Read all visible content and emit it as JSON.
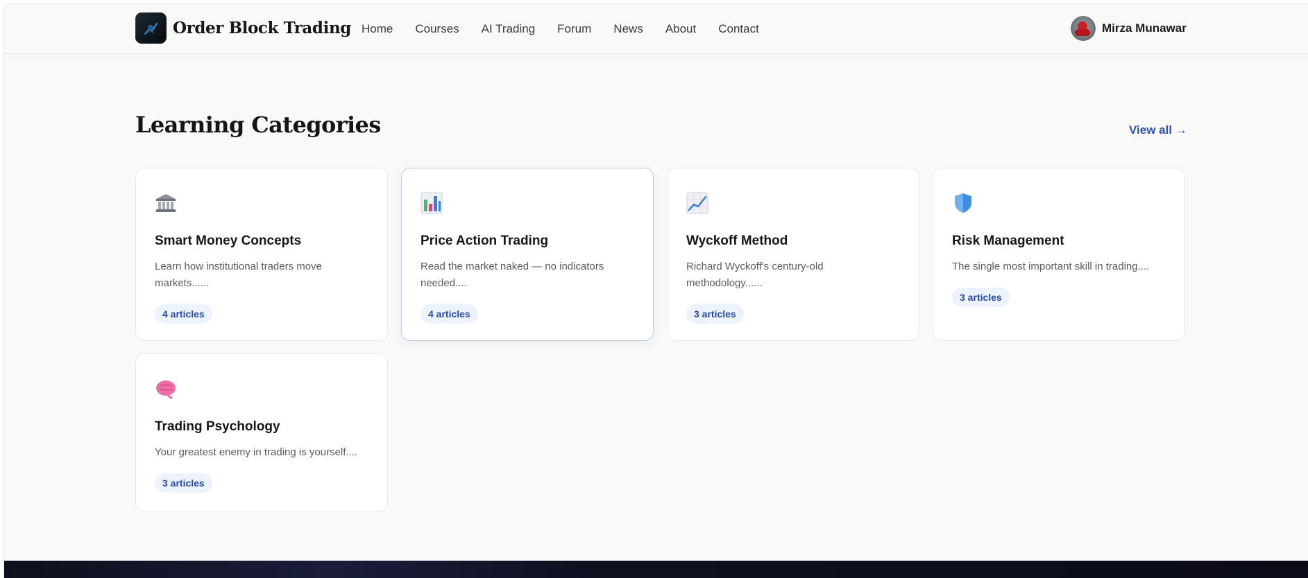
{
  "header": {
    "brand_name": "Order Block Trading",
    "nav": [
      "Home",
      "Courses",
      "AI Trading",
      "Forum",
      "News",
      "About",
      "Contact"
    ],
    "user_name": "Mirza Munawar"
  },
  "section": {
    "title": "Learning Categories",
    "view_all": "View all →"
  },
  "categories": [
    {
      "icon": "bank-icon",
      "title": "Smart Money Concepts",
      "description": "Learn how institutional traders move markets......",
      "badge": "4 articles"
    },
    {
      "icon": "bar-chart-icon",
      "title": "Price Action Trading",
      "description": "Read the market naked — no indicators needed....",
      "badge": "4 articles"
    },
    {
      "icon": "trending-up-chart-icon",
      "title": "Wyckoff Method",
      "description": "Richard Wyckoff's century-old methodology......",
      "badge": "3 articles"
    },
    {
      "icon": "shield-icon",
      "title": "Risk Management",
      "description": "The single most important skill in trading....",
      "badge": "3 articles"
    },
    {
      "icon": "brain-icon",
      "title": "Trading Psychology",
      "description": "Your greatest enemy in trading is yourself....",
      "badge": "3 articles"
    }
  ],
  "colors": {
    "accent": "#2a4fb0",
    "badge_bg": "#edf3fc",
    "page_bg": "#f9f9f7",
    "footer_bg": "#0d0f1c"
  }
}
